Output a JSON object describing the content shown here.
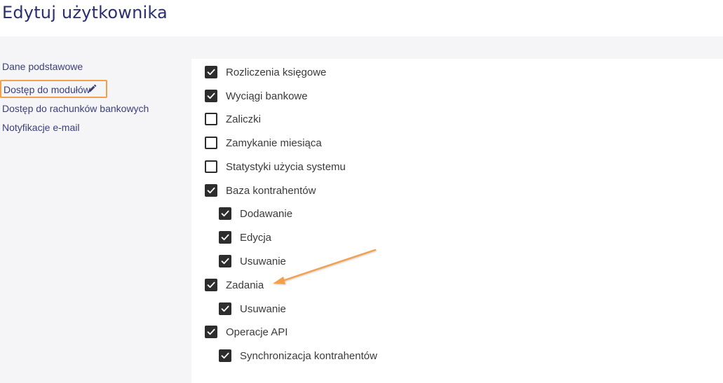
{
  "page": {
    "title": "Edytuj użytkownika"
  },
  "sidebar": {
    "items": [
      {
        "label": "Dane podstawowe"
      },
      {
        "label": "Dostęp do modułów"
      },
      {
        "label": "Dostęp do rachunków bankowych"
      },
      {
        "label": "Notyfikacje e-mail"
      }
    ],
    "active_index": 1
  },
  "modules": [
    {
      "label": "Rozliczenia księgowe",
      "checked": true,
      "level": 0
    },
    {
      "label": "Wyciągi bankowe",
      "checked": true,
      "level": 0
    },
    {
      "label": "Zaliczki",
      "checked": false,
      "level": 0
    },
    {
      "label": "Zamykanie miesiąca",
      "checked": false,
      "level": 0
    },
    {
      "label": "Statystyki użycia systemu",
      "checked": false,
      "level": 0
    },
    {
      "label": "Baza kontrahentów",
      "checked": true,
      "level": 0
    },
    {
      "label": "Dodawanie",
      "checked": true,
      "level": 1
    },
    {
      "label": "Edycja",
      "checked": true,
      "level": 1
    },
    {
      "label": "Usuwanie",
      "checked": true,
      "level": 1
    },
    {
      "label": "Zadania",
      "checked": true,
      "level": 0
    },
    {
      "label": "Usuwanie",
      "checked": true,
      "level": 1
    },
    {
      "label": "Operacje API",
      "checked": true,
      "level": 0
    },
    {
      "label": "Synchronizacja kontrahentów",
      "checked": true,
      "level": 1
    }
  ],
  "colors": {
    "accent": "#f3a04c",
    "title": "#2b2f6e",
    "sidebar_text": "#3a3f7a",
    "checkbox": "#2d2d2d"
  },
  "icons": {
    "edit": "pencil-icon",
    "annotation": "arrow-annotation"
  }
}
